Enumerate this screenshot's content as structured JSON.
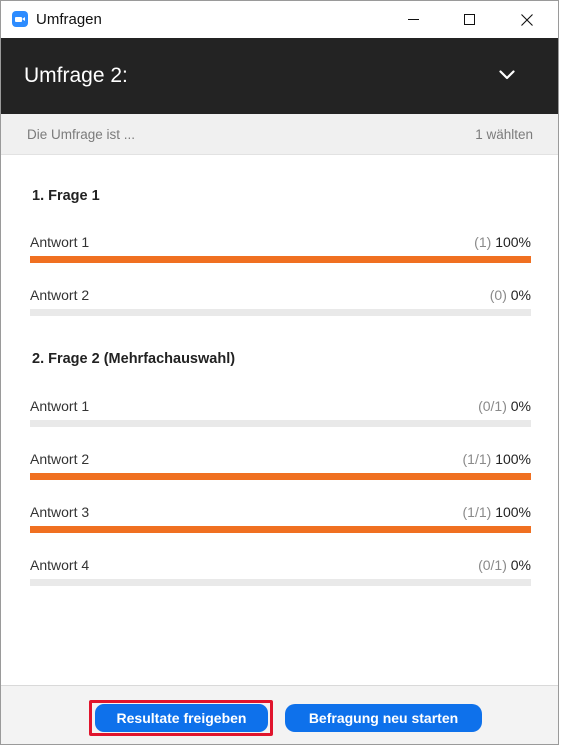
{
  "window": {
    "title": "Umfragen"
  },
  "header": {
    "poll_title": "Umfrage 2:"
  },
  "status": {
    "left": "Die Umfrage ist ...",
    "right": "1 wählten"
  },
  "questions": [
    {
      "title": "1. Frage 1",
      "answers": [
        {
          "label": "Antwort 1",
          "count": "(1)",
          "percent": "100%",
          "fraction": 1.0
        },
        {
          "label": "Antwort 2",
          "count": "(0)",
          "percent": "0%",
          "fraction": 0.0
        }
      ]
    },
    {
      "title": "2. Frage 2 (Mehrfachauswahl)",
      "answers": [
        {
          "label": "Antwort 1",
          "count": "(0/1)",
          "percent": "0%",
          "fraction": 0.0
        },
        {
          "label": "Antwort 2",
          "count": "(1/1)",
          "percent": "100%",
          "fraction": 1.0
        },
        {
          "label": "Antwort 3",
          "count": "(1/1)",
          "percent": "100%",
          "fraction": 1.0
        },
        {
          "label": "Antwort 4",
          "count": "(0/1)",
          "percent": "0%",
          "fraction": 0.0
        }
      ]
    }
  ],
  "footer": {
    "share_label": "Resultate freigeben",
    "restart_label": "Befragung neu starten"
  },
  "colors": {
    "accent": "#0e71eb",
    "bar_fill": "#f07021",
    "header_bg": "#232323",
    "highlight_outline": "#e0152d"
  }
}
